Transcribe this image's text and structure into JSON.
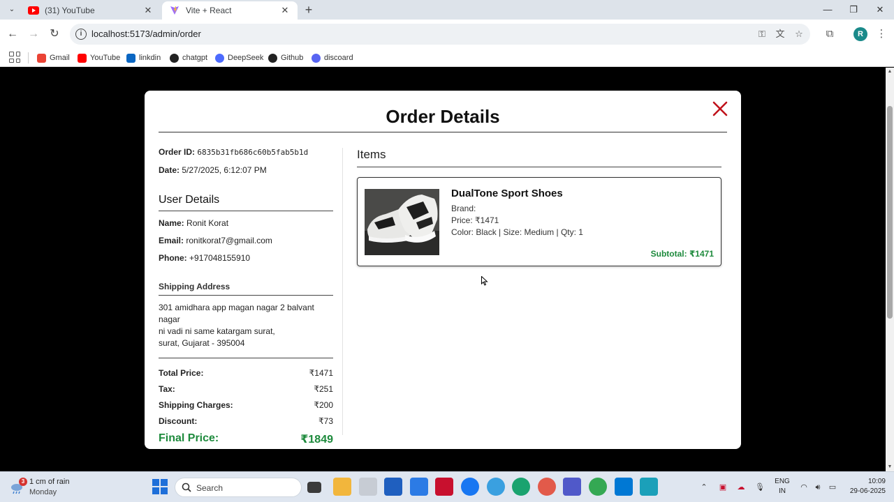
{
  "browser": {
    "tabs": [
      {
        "title": "(31) YouTube",
        "icon": "youtube-icon"
      },
      {
        "title": "Vite + React",
        "icon": "vite-icon"
      }
    ],
    "url": "localhost:5173/admin/order",
    "profile_initial": "R",
    "bookmarks": [
      {
        "label": "Gmail",
        "icon": "gmail-icon",
        "color": "#ea4335"
      },
      {
        "label": "YouTube",
        "icon": "youtube-icon",
        "color": "#ff0000"
      },
      {
        "label": "linkdin",
        "icon": "linkedin-icon",
        "color": "#0a66c2"
      },
      {
        "label": "chatgpt",
        "icon": "chatgpt-icon",
        "color": "#222222"
      },
      {
        "label": "DeepSeek",
        "icon": "deepseek-icon",
        "color": "#4d6bfe"
      },
      {
        "label": "Github",
        "icon": "github-icon",
        "color": "#222222"
      },
      {
        "label": "discoard",
        "icon": "discord-icon",
        "color": "#5865f2"
      }
    ]
  },
  "modal": {
    "title": "Order Details",
    "order_id_label": "Order ID:",
    "order_id": "6835b31fb686c60b5fab5b1d",
    "date_label": "Date:",
    "date": "5/27/2025, 6:12:07 PM",
    "user_section": "User Details",
    "name_label": "Name:",
    "name": "Ronit Korat",
    "email_label": "Email:",
    "email": "ronitkorat7@gmail.com",
    "phone_label": "Phone:",
    "phone": "+917048155910",
    "shipping_section": "Shipping Address",
    "address_line1": "301 amidhara app magan nagar 2 balvant nagar",
    "address_line2": "ni vadi ni same katargam surat,",
    "address_line3": "surat, Gujarat - 395004",
    "pricing": {
      "total_label": "Total Price:",
      "total": "₹1471",
      "tax_label": "Tax:",
      "tax": "₹251",
      "shipping_label": "Shipping Charges:",
      "shipping": "₹200",
      "discount_label": "Discount:",
      "discount": "₹73",
      "final_label": "Final Price:",
      "final": "₹1849"
    },
    "items_section": "Items",
    "items": [
      {
        "name": "DualTone Sport Shoes",
        "brand": "Brand:",
        "price": "Price: ₹1471",
        "variant": "Color: Black | Size: Medium | Qty: 1",
        "subtotal": "Subtotal: ₹1471"
      }
    ]
  },
  "colors": {
    "accent_green": "#1d8a3c",
    "close_red": "#c0121b"
  },
  "taskbar": {
    "weather_badge": "3",
    "weather_line1": "1 cm of rain",
    "weather_line2": "Monday",
    "search_placeholder": "Search",
    "lang_line1": "ENG",
    "lang_line2": "IN",
    "time": "10:09",
    "date": "29-06-2025"
  }
}
